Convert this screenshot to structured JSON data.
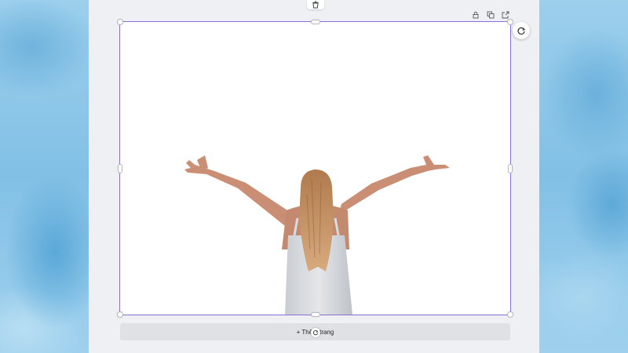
{
  "editor": {
    "add_page_label": "+ Thêm trang",
    "icons": {
      "trash": "trash-icon",
      "lock": "lock-icon",
      "duplicate": "duplicate-icon",
      "share": "share-icon",
      "refresh": "refresh-icon",
      "rotate": "rotate-icon"
    }
  },
  "colors": {
    "selection": "#8a6fd6",
    "panel": "#eef0f3",
    "background": "#8fc6e6"
  }
}
